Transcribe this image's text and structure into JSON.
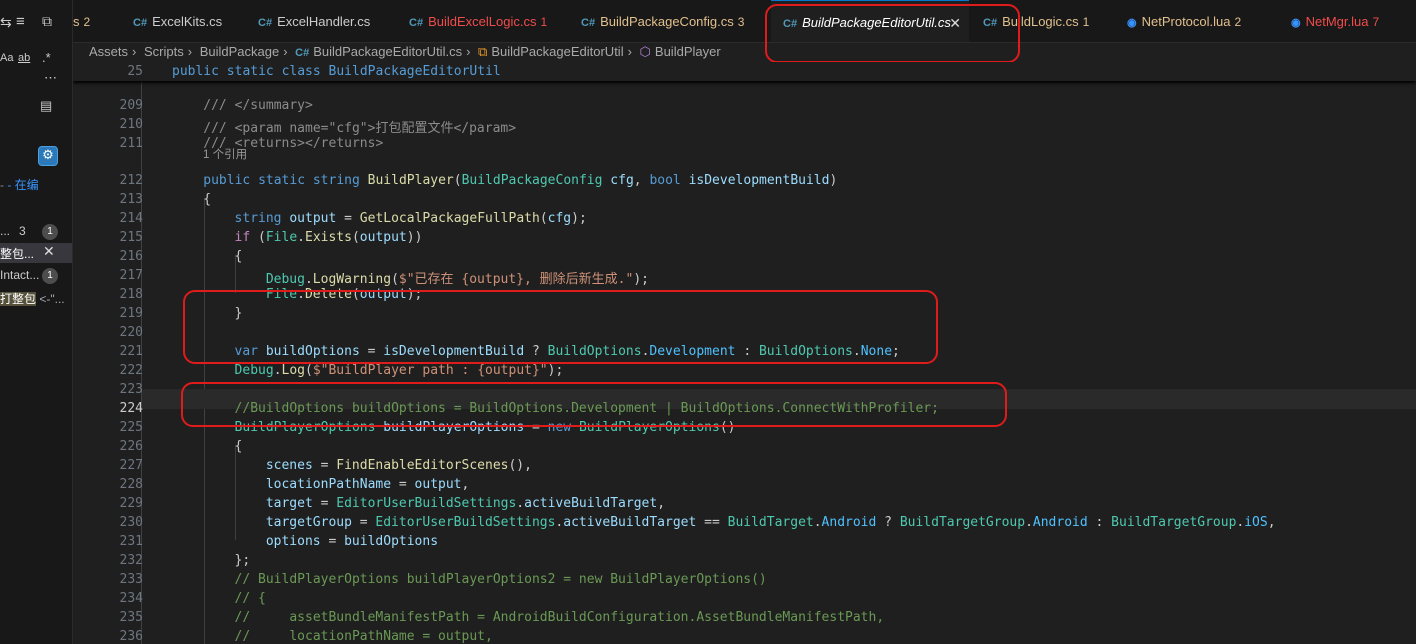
{
  "sidebar": {
    "row1_suffix": "- 在编",
    "item1_label": "...",
    "item1_count": "3",
    "item1_badge": "1",
    "item2_label": "整包...",
    "item3_label": "Intact...",
    "item3_badge": "1",
    "item4_label": "打整包",
    "item4_suffix": "<-\"...",
    "search_opts": [
      "Aa",
      "ab",
      ".*"
    ]
  },
  "tabs": [
    {
      "name": "s",
      "count": "2",
      "icon": "",
      "color": "#e2c08d"
    },
    {
      "name": "ExcelKits.cs",
      "count": "",
      "icon": "C#",
      "color": "#cccccc"
    },
    {
      "name": "ExcelHandler.cs",
      "count": "",
      "icon": "C#",
      "color": "#cccccc"
    },
    {
      "name": "BuildExcelLogic.cs",
      "count": "1",
      "icon": "C#",
      "color": "#f14c4c"
    },
    {
      "name": "BuildPackageConfig.cs",
      "count": "3",
      "icon": "C#",
      "color": "#e2c08d"
    },
    {
      "name": "BuildPackageEditorUtil.cs",
      "count": "",
      "icon": "C#",
      "color": "#ffffff"
    },
    {
      "name": "BuildLogic.cs",
      "count": "1",
      "icon": "C#",
      "color": "#e2c08d"
    },
    {
      "name": "NetProtocol.lua",
      "count": "2",
      "icon": "◉",
      "color": "#e2c08d"
    },
    {
      "name": "NetMgr.lua",
      "count": "7",
      "icon": "◉",
      "color": "#f14c4c"
    }
  ],
  "breadcrumb": [
    "Assets",
    "Scripts",
    "BuildPackage",
    "BuildPackageEditorUtil.cs",
    "BuildPackageEditorUtil",
    "BuildPlayer"
  ],
  "code": {
    "sticky_line_number": "25",
    "sticky_text": "public static class BuildPackageEditorUtil",
    "codelens": "1 个引用",
    "lines": [
      {
        "n": "209",
        "t": "/// </summary>"
      },
      {
        "n": "210",
        "t": "/// <param name=\"cfg\">打包配置文件</param>"
      },
      {
        "n": "211",
        "t": "/// <returns></returns>"
      },
      {
        "n": "212",
        "t": "public static string BuildPlayer(BuildPackageConfig cfg, bool isDevelopmentBuild)"
      },
      {
        "n": "213",
        "t": "{"
      },
      {
        "n": "214",
        "t": "string output = GetLocalPackageFullPath(cfg);"
      },
      {
        "n": "215",
        "t": "if (File.Exists(output))"
      },
      {
        "n": "216",
        "t": "{"
      },
      {
        "n": "217",
        "t": "Debug.LogWarning($\"已存在 {output}, 删除后新生成.\");"
      },
      {
        "n": "218",
        "t": "File.Delete(output);"
      },
      {
        "n": "219",
        "t": "}"
      },
      {
        "n": "220",
        "t": ""
      },
      {
        "n": "221",
        "t": "var buildOptions = isDevelopmentBuild ? BuildOptions.Development : BuildOptions.None;"
      },
      {
        "n": "222",
        "t": "Debug.Log($\"BuildPlayer path : {output}\");"
      },
      {
        "n": "223",
        "t": ""
      },
      {
        "n": "224",
        "t": "//BuildOptions buildOptions = BuildOptions.Development | BuildOptions.ConnectWithProfiler;"
      },
      {
        "n": "225",
        "t": "BuildPlayerOptions buildPlayerOptions = new BuildPlayerOptions()"
      },
      {
        "n": "226",
        "t": "{"
      },
      {
        "n": "227",
        "t": "scenes = FindEnableEditorScenes(),"
      },
      {
        "n": "228",
        "t": "locationPathName = output,"
      },
      {
        "n": "229",
        "t": "target = EditorUserBuildSettings.activeBuildTarget,"
      },
      {
        "n": "230",
        "t": "targetGroup = EditorUserBuildSettings.activeBuildTarget == BuildTarget.Android ? BuildTargetGroup.Android : BuildTargetGroup.iOS,"
      },
      {
        "n": "231",
        "t": "options = buildOptions"
      },
      {
        "n": "232",
        "t": "};"
      },
      {
        "n": "233",
        "t": "// BuildPlayerOptions buildPlayerOptions2 = new BuildPlayerOptions()"
      },
      {
        "n": "234",
        "t": "// {"
      },
      {
        "n": "235",
        "t": "//     assetBundleManifestPath = AndroidBuildConfiguration.AssetBundleManifestPath,"
      },
      {
        "n": "236",
        "t": "//     locationPathName = output,"
      }
    ]
  },
  "colors": {
    "annotation_box": "#e01b1b",
    "active_tab_accent": "#0078d4"
  }
}
